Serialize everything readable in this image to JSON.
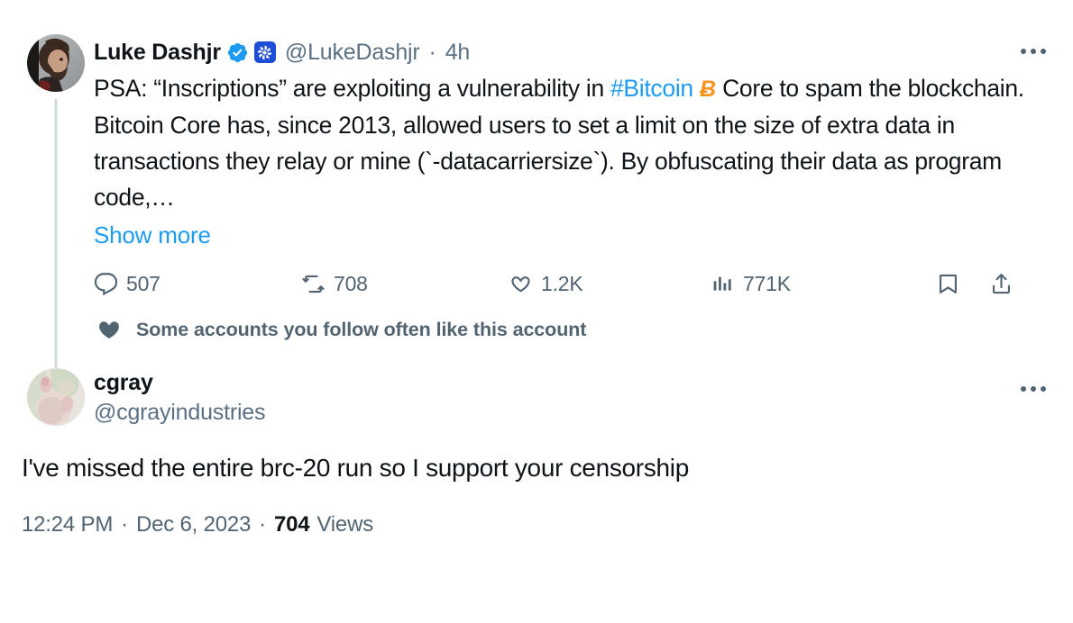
{
  "theme": {
    "accent_blue": "#1d9bf0",
    "verified_blue": "#1d9bf0",
    "affiliate_badge_bg": "#1d4ed8",
    "bitcoin_orange": "#f7931a",
    "text_primary": "#0f1419",
    "text_secondary": "#536471",
    "thread_line": "#cfd9de",
    "background": "#ffffff"
  },
  "main_tweet": {
    "author": {
      "display_name": "Luke Dashjr",
      "handle": "@LukeDashjr",
      "verified": true,
      "affiliate_badge": "pinwheel-icon"
    },
    "timestamp_relative": "4h",
    "separator": "·",
    "text_parts": {
      "before_hashtag": "PSA: “Inscriptions” are exploiting a vulnerability in ",
      "hashtag": "#Bitcoin",
      "bitcoin_glyph": "Ƀ",
      "after_hashtag": " Core to spam the blockchain. Bitcoin Core has, since 2013, allowed users to set a limit on the size of extra data in transactions they relay or mine (`-datacarriersize`). By obfuscating their data as program code,…"
    },
    "full_text": "PSA: “Inscriptions” are exploiting a vulnerability in #Bitcoin Ƀ Core to spam the blockchain. Bitcoin Core has, since 2013, allowed users to set a limit on the size of extra data in transactions they relay or mine (`-datacarriersize`). By obfuscating their data as program code,…",
    "show_more_label": "Show more",
    "more_button": "more-options-icon",
    "actions": [
      {
        "name": "reply",
        "icon": "reply-icon",
        "count": "507"
      },
      {
        "name": "retweet",
        "icon": "retweet-icon",
        "count": "708"
      },
      {
        "name": "like",
        "icon": "heart-icon",
        "count": "1.2K"
      },
      {
        "name": "views",
        "icon": "analytics-icon",
        "count": "771K"
      },
      {
        "name": "bookmark",
        "icon": "bookmark-icon",
        "count": ""
      },
      {
        "name": "share",
        "icon": "share-icon",
        "count": ""
      }
    ],
    "social_proof": {
      "icon": "heart-filled-icon",
      "text": "Some accounts you follow often like this account"
    }
  },
  "reply_tweet": {
    "author": {
      "display_name": "cgray",
      "handle": "@cgrayindustries"
    },
    "more_button": "more-options-icon",
    "text": "I've missed the entire brc-20 run so I support your censorship",
    "meta": {
      "time": "12:24 PM",
      "sep1": "·",
      "date": "Dec 6, 2023",
      "sep2": "·",
      "views_count": "704",
      "views_label": "Views"
    }
  }
}
